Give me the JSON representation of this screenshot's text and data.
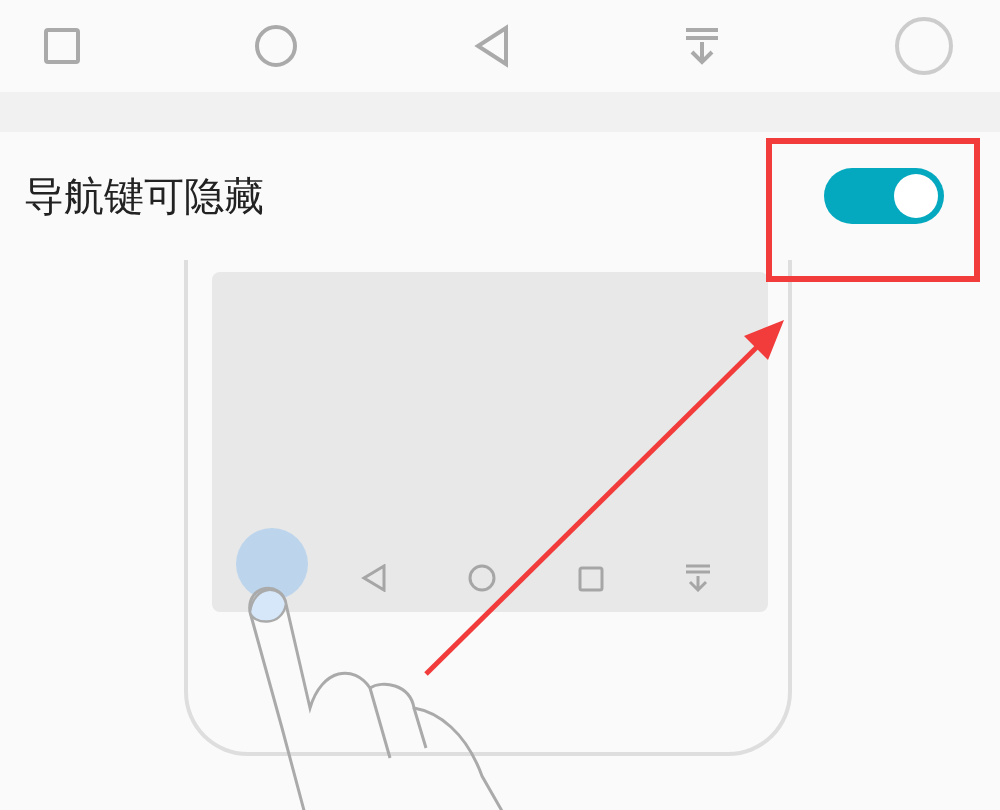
{
  "setting": {
    "label": "导航键可隐藏",
    "on": true
  }
}
